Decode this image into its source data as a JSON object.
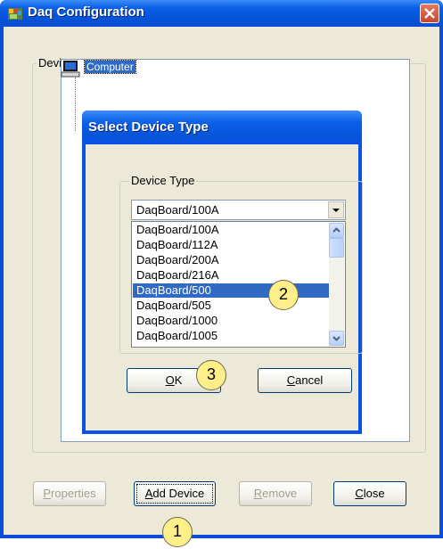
{
  "window": {
    "title": "Daq Configuration",
    "icons": {
      "app": "daq-app-icon",
      "close": "close-icon"
    }
  },
  "inventory": {
    "legend": "Device Inventory",
    "tree_root": {
      "label": "Computer",
      "icon": "computer-icon"
    }
  },
  "dialog": {
    "title": "Select Device Type",
    "group_legend": "Device Type",
    "combo_value": "DaqBoard/100A",
    "list_items": [
      "DaqBoard/100A",
      "DaqBoard/112A",
      "DaqBoard/200A",
      "DaqBoard/216A",
      "DaqBoard/500",
      "DaqBoard/505",
      "DaqBoard/1000",
      "DaqBoard/1005"
    ],
    "selected_index": 4,
    "ok_mnemonic": "O",
    "ok_rest": "K",
    "cancel_mnemonic": "C",
    "cancel_rest": "ancel"
  },
  "buttons": {
    "properties_mnemonic": "P",
    "properties_rest": "roperties",
    "add_mnemonic": "A",
    "add_rest": "dd Device",
    "remove_mnemonic": "R",
    "remove_rest": "emove",
    "close_mnemonic": "C",
    "close_rest": "lose"
  },
  "callouts": {
    "one": "1",
    "two": "2",
    "three": "3"
  },
  "colors": {
    "title_blue": "#0a5fe6",
    "selection": "#316ac5",
    "callout_fill": "#ffef8a",
    "face": "#ece9d8"
  }
}
